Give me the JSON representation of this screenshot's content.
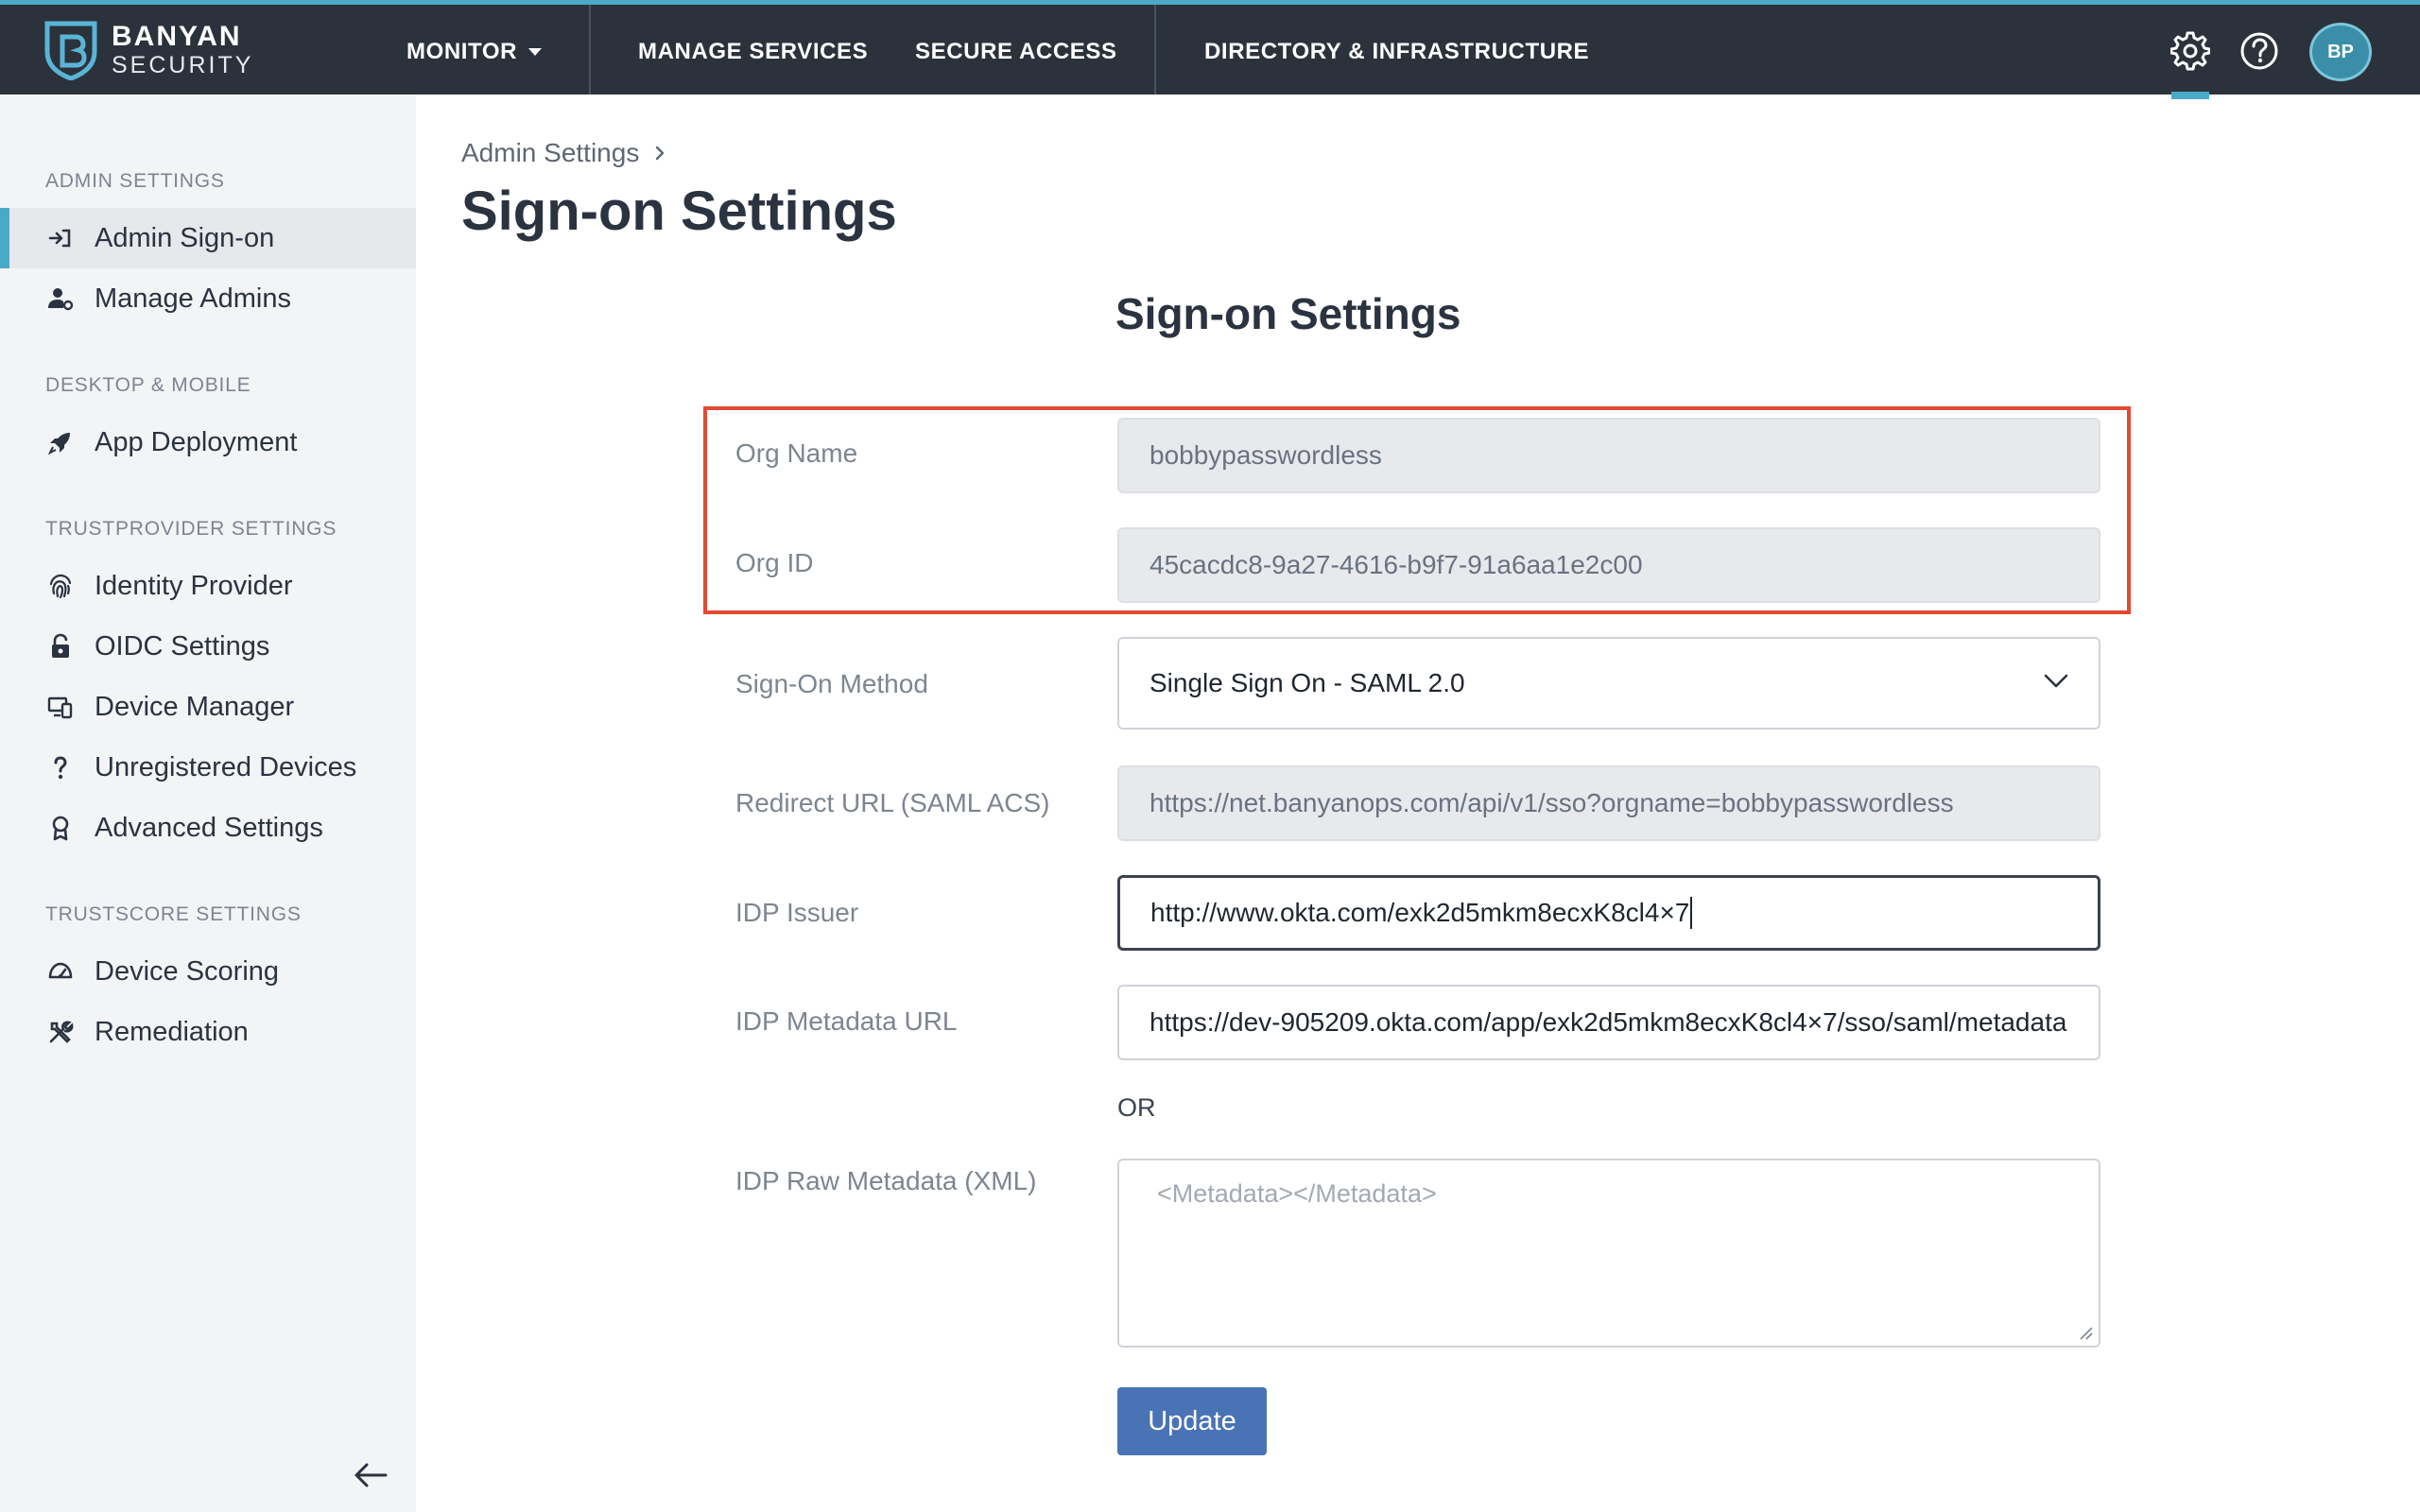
{
  "brand": {
    "name_line1": "BANYAN",
    "name_line2": "SECURITY"
  },
  "topnav": {
    "monitor": "MONITOR",
    "manage_services": "MANAGE SERVICES",
    "secure_access": "SECURE ACCESS",
    "directory": "DIRECTORY & INFRASTRUCTURE",
    "settings_icon": "gear-icon",
    "help_icon": "question-circle-icon",
    "avatar_initials": "BP",
    "accent_color": "#4aa9c9"
  },
  "sidebar": {
    "sections": [
      {
        "title": "ADMIN SETTINGS",
        "items": [
          {
            "label": "Admin Sign-on",
            "icon": "sign-in-icon",
            "active": true
          },
          {
            "label": "Manage Admins",
            "icon": "user-gear-icon"
          }
        ]
      },
      {
        "title": "DESKTOP & MOBILE",
        "items": [
          {
            "label": "App Deployment",
            "icon": "rocket-icon"
          }
        ]
      },
      {
        "title": "TRUSTPROVIDER SETTINGS",
        "items": [
          {
            "label": "Identity Provider",
            "icon": "fingerprint-icon"
          },
          {
            "label": "OIDC Settings",
            "icon": "lock-icon"
          },
          {
            "label": "Device Manager",
            "icon": "devices-icon"
          },
          {
            "label": "Unregistered Devices",
            "icon": "question-icon"
          },
          {
            "label": "Advanced Settings",
            "icon": "award-icon"
          }
        ]
      },
      {
        "title": "TRUSTSCORE SETTINGS",
        "items": [
          {
            "label": "Device Scoring",
            "icon": "gauge-icon"
          },
          {
            "label": "Remediation",
            "icon": "tools-icon"
          }
        ]
      }
    ],
    "collapse_icon": "arrow-left-icon"
  },
  "breadcrumb": {
    "parent": "Admin Settings"
  },
  "page_title": "Sign-on Settings",
  "form": {
    "title": "Sign-on Settings",
    "org_name": {
      "label": "Org Name",
      "value": "bobbypasswordless"
    },
    "org_id": {
      "label": "Org ID",
      "value": "45cacdc8-9a27-4616-b9f7-91a6aa1e2c00"
    },
    "sign_on_method": {
      "label": "Sign-On Method",
      "value": "Single Sign On - SAML 2.0"
    },
    "redirect_url": {
      "label": "Redirect URL (SAML ACS)",
      "value": "https://net.banyanops.com/api/v1/sso?orgname=bobbypasswordless"
    },
    "idp_issuer": {
      "label": "IDP Issuer",
      "value": "http://www.okta.com/exk2d5mkm8ecxK8cl4×7"
    },
    "idp_metadata_url": {
      "label": "IDP Metadata URL",
      "value": "https://dev-905209.okta.com/app/exk2d5mkm8ecxK8cl4×7/sso/saml/metadata"
    },
    "or_text": "OR",
    "idp_raw_metadata": {
      "label": "IDP Raw Metadata (XML)",
      "placeholder": "<Metadata></Metadata>"
    },
    "update_label": "Update",
    "highlight_color": "#e24a33",
    "button_color": "#4a73b5"
  }
}
